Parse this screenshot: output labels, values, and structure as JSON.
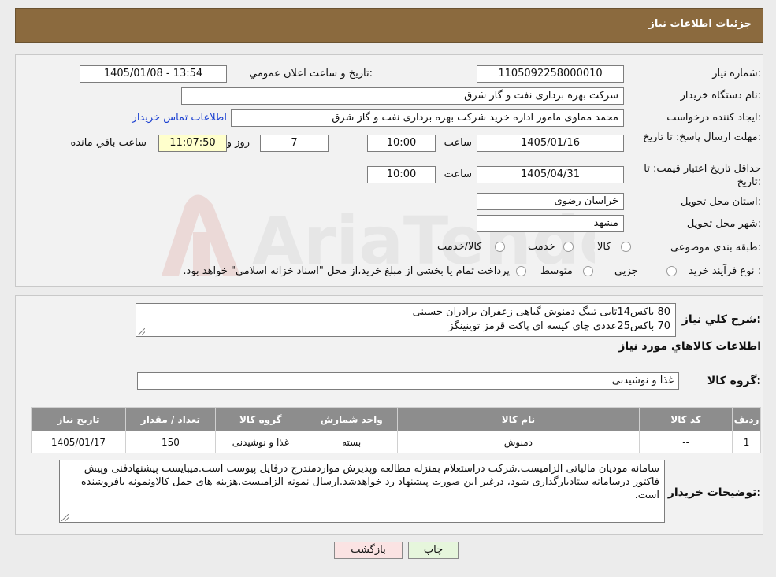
{
  "page": {
    "title": "جزئیات اطلاعات نیاز"
  },
  "form": {
    "need_number_label": "شماره نیاز:",
    "need_number": "1105092258000010",
    "announce_label": "تاریخ و ساعت اعلان عمومي:",
    "announce_value": "1405/01/08 - 13:54",
    "buyer_org_label": "نام دستگاه خريدار:",
    "buyer_org": "شرکت بهره برداری نفت و گاز شرق",
    "creator_label": "ايجاد کننده درخواست:",
    "creator": "محمد مماوی مامور اداره خرید شرکت بهره برداری نفت و گاز شرق",
    "contact_link": "اطلاعات تماس خريدار",
    "deadline_label": "مهلت ارسال پاسخ: تا تاريخ:",
    "deadline_date": "1405/01/16",
    "time_label": "ساعت",
    "deadline_time": "10:00",
    "days_value": "7",
    "days_label": "روز و",
    "remaining_value": "11:07:50",
    "remaining_label": "ساعت باقي مانده",
    "validity_label": "حداقل تاريخ اعتبار قيمت: تا تاريخ:",
    "validity_date": "1405/04/31",
    "validity_time": "10:00",
    "province_label": "استان محل تحويل:",
    "province": "خراسان رضوی",
    "city_label": "شهر محل تحويل:",
    "city": "مشهد",
    "category_label": "طبقه بندی موضوعی:",
    "category_options": [
      "کالا",
      "خدمت",
      "کالا/خدمت"
    ],
    "process_label": "نوع فرآيند خريد :",
    "process_options": [
      "جزيي",
      "متوسط"
    ],
    "process_note": "پرداخت تمام یا بخشی از مبلغ خرید،از محل \"اسناد خزانه اسلامی\" خواهد بود."
  },
  "summary": {
    "label": "شرح کلي نياز:",
    "line1": "80 باکس14تایی تیبگ دمنوش گیاهی زعفران برادران حسینی",
    "line2": "70 باکس25عددی چای کیسه ای پاکت قرمز توینینگز"
  },
  "goods": {
    "section_title": "اطلاعات کالاهاي مورد نياز",
    "group_label": "گروه کالا:",
    "group_value": "غذا و نوشیدنی",
    "columns": [
      "رديف",
      "کد کالا",
      "نام کالا",
      "واحد شمارش",
      "گروه کالا",
      "تعداد / مقدار",
      "تاريخ نياز"
    ],
    "rows": [
      [
        "1",
        "--",
        "دمنوش",
        "بسته",
        "غذا و نوشیدنی",
        "150",
        "1405/01/17"
      ]
    ]
  },
  "notes": {
    "label": "توضيحات خريدار:",
    "text": "سامانه مودیان مالیاتی الزامیست.شرکت دراستعلام بمنزله مطالعه وپذیرش مواردمندرج درفایل پیوست است.میبایست پیشنهادفنی وپیش فاکتور درسامانه ستادبارگذاری شود، درغیر این صورت پیشنهاد رد خواهدشد.ارسال نمونه الزامیست.هزینه های حمل کالاونمونه بافروشنده است."
  },
  "buttons": {
    "print": "چاپ",
    "back": "بازگشت"
  },
  "watermark": {
    "text": "AriaTender.neT"
  },
  "colors": {
    "header": "#8b6a3e",
    "table_header": "#8d8d8d",
    "back_button": "#fbe3e3",
    "print_button": "#e6f6dc"
  }
}
